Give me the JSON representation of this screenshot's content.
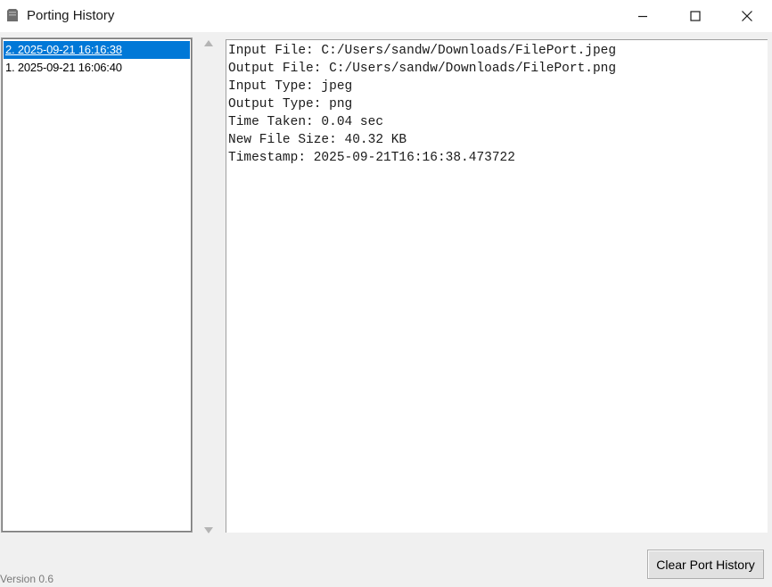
{
  "window": {
    "title": "Porting History"
  },
  "history_list": {
    "items": [
      {
        "label": "2. 2025-09-21 16:16:38",
        "selected": true
      },
      {
        "label": "1. 2025-09-21 16:06:40",
        "selected": false
      }
    ]
  },
  "details": {
    "lines": [
      "Input File: C:/Users/sandw/Downloads/FilePort.jpeg",
      "Output File: C:/Users/sandw/Downloads/FilePort.png",
      "Input Type: jpeg",
      "Output Type: png",
      "Time Taken: 0.04 sec",
      "New File Size: 40.32 KB",
      "Timestamp: 2025-09-21T16:16:38.473722"
    ]
  },
  "footer": {
    "version": "Version 0.6",
    "clear_button_label": "Clear Port History"
  },
  "colors": {
    "selection": "#0078d7",
    "window_bg": "#f0f0f0"
  }
}
